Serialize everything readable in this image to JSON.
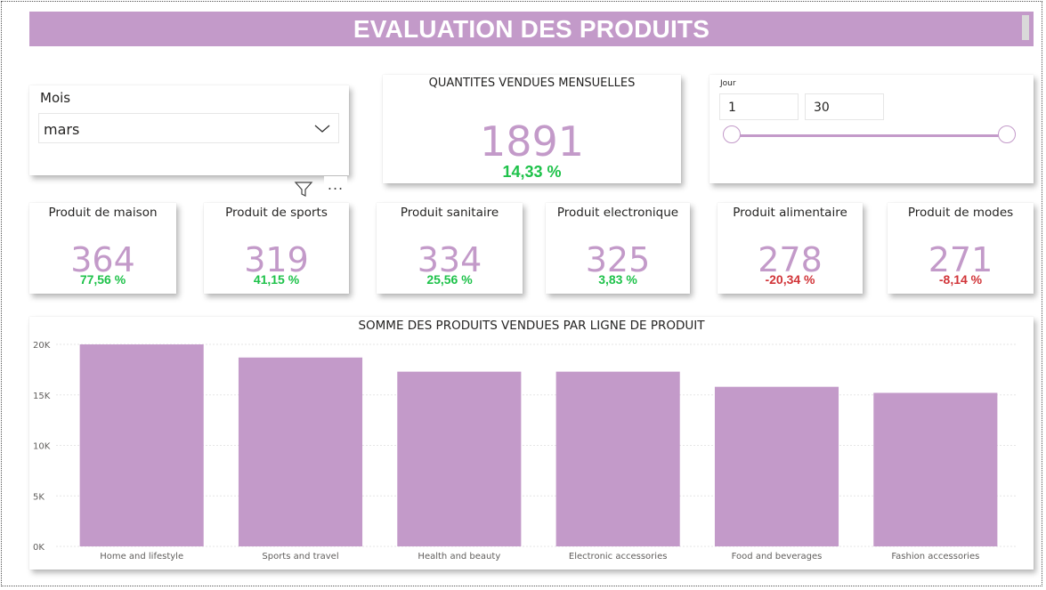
{
  "header": {
    "title": "EVALUATION DES PRODUITS"
  },
  "mois_slicer": {
    "label": "Mois",
    "value": "mars"
  },
  "visual_header": {
    "more_label": "..."
  },
  "kpi_main": {
    "title": "QUANTITES VENDUES MENSUELLES",
    "value": "1891",
    "change": "14,33 %",
    "change_direction": "up"
  },
  "jour_slicer": {
    "label": "Jour",
    "start": "1",
    "end": "30",
    "range": [
      1,
      30
    ]
  },
  "products": [
    {
      "title": "Produit de maison",
      "value": "364",
      "change": "77,56 %",
      "direction": "up"
    },
    {
      "title": "Produit de sports",
      "value": "319",
      "change": "41,15 %",
      "direction": "up"
    },
    {
      "title": "Produit sanitaire",
      "value": "334",
      "change": "25,56 %",
      "direction": "up"
    },
    {
      "title": "Produit electronique",
      "value": "325",
      "change": "3,83 %",
      "direction": "up"
    },
    {
      "title": "Produit alimentaire",
      "value": "278",
      "change": "-20,34 %",
      "direction": "down"
    },
    {
      "title": "Produit de modes",
      "value": "271",
      "change": "-8,14 %",
      "direction": "down"
    }
  ],
  "colors": {
    "accent": "#c39ac9",
    "positive": "#1ec24a",
    "negative": "#d13438"
  },
  "chart_data": {
    "type": "bar",
    "title": "SOMME DES PRODUITS VENDUES PAR LIGNE DE PRODUIT",
    "categories": [
      "Home and lifestyle",
      "Sports and travel",
      "Health and beauty",
      "Electronic accessories",
      "Food and beverages",
      "Fashion accessories"
    ],
    "values": [
      20000,
      18700,
      17300,
      17300,
      15800,
      15200
    ],
    "yticks": [
      "0K",
      "5K",
      "10K",
      "15K",
      "20K"
    ],
    "ylim": [
      0,
      20000
    ],
    "grid": true,
    "color": "#c39ac9"
  }
}
